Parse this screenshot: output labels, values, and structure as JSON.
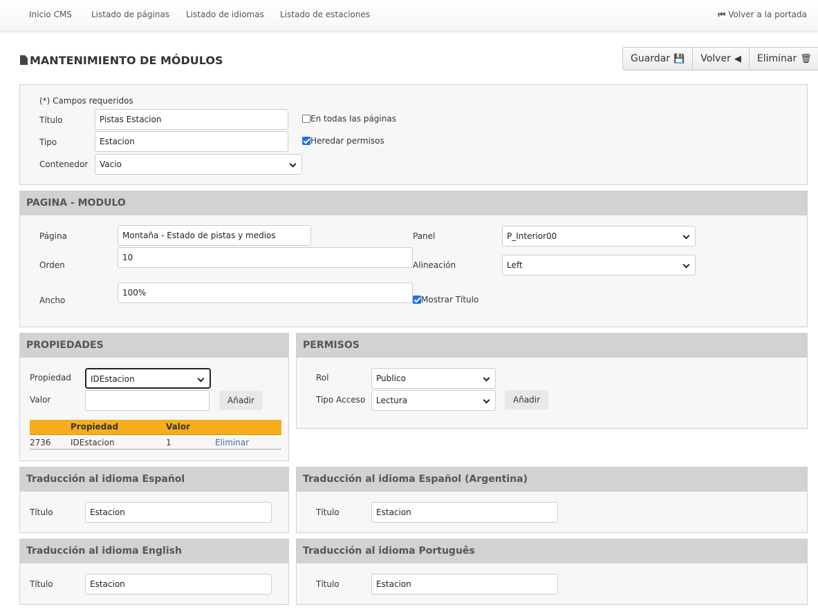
{
  "nav": {
    "items": [
      "Inicio CMS",
      "Listado de páginas",
      "Listado de idiomas",
      "Listado de estaciones"
    ],
    "back_home": "Volver a la portada"
  },
  "header": {
    "title": "MANTENIMIENTO DE MÓDULOS",
    "buttons": {
      "save": "Guardar",
      "back": "Volver",
      "delete": "Eliminar"
    }
  },
  "general": {
    "required_note": "(*) Campos requeridos",
    "title_label": "Título",
    "title_value": "Pistas Estacion",
    "type_label": "Tipo",
    "type_value": "Estacion",
    "container_label": "Contenedor",
    "container_value": "Vacio",
    "all_pages_label": "En todas las páginas",
    "all_pages_checked": false,
    "inherit_label": "Heredar permisos",
    "inherit_checked": true
  },
  "page_module": {
    "heading": "PAGINA - MODULO",
    "page_label": "Página",
    "page_value": "Montaña - Estado de pistas y medios",
    "order_label": "Orden",
    "order_value": "10",
    "width_label": "Ancho",
    "width_value": "100%",
    "panel_label": "Panel",
    "panel_value": "P_Interior00",
    "align_label": "Alineación",
    "align_value": "Left",
    "show_title_label": "Mostrar Título",
    "show_title_checked": true
  },
  "properties": {
    "heading": "PROPIEDADES",
    "property_label": "Propiedad",
    "property_value": "IDEstacion",
    "value_label": "Valor",
    "value_value": "",
    "add_label": "Añadir",
    "table_headers": [
      "",
      "Propiedad",
      "Valor",
      ""
    ],
    "rows": [
      {
        "id": "2736",
        "property": "IDEstacion",
        "value": "1",
        "action": "Eliminar"
      }
    ]
  },
  "permissions": {
    "heading": "PERMISOS",
    "role_label": "Rol",
    "role_value": "Publico",
    "access_label": "Tipo Acceso",
    "access_value": "Lectura",
    "add_label": "Añadir"
  },
  "translations": [
    {
      "heading": "Traducción al idioma Español",
      "label": "Título",
      "value": "Estacion"
    },
    {
      "heading": "Traducción al idioma Español (Argentina)",
      "label": "Título",
      "value": "Estacion"
    },
    {
      "heading": "Traducción al idioma English",
      "label": "Título",
      "value": "Estacion"
    },
    {
      "heading": "Traducción al idioma Português",
      "label": "Título",
      "value": "Estacion"
    }
  ],
  "colors": {
    "table_header": "#f5ad1b",
    "panel_header": "#d2d2d2",
    "checkbox_accent": "#1a73e8",
    "link": "#3a6ea5"
  }
}
